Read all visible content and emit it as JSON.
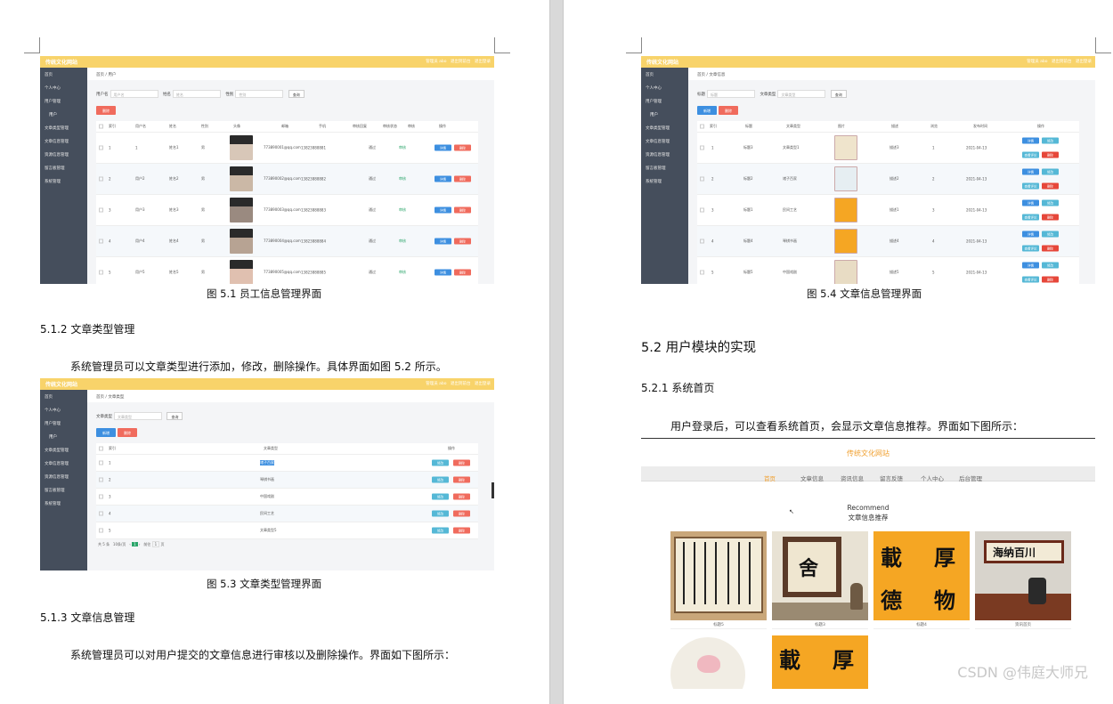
{
  "left_page": {
    "fig1_caption": "图 5.1 员工信息管理界面",
    "sec_513_heading": "5.1.2 文章类型管理",
    "sec_513_para": "系统管理员可以文章类型进行添加，修改，删除操作。具体界面如图 5.2 所示。",
    "fig3_caption": "图 5.3 文章类型管理界面",
    "sec_info_heading": "5.1.3 文章信息管理",
    "sec_info_para": "系统管理员可以对用户提交的文章信息进行审核以及删除操作。界面如下图所示："
  },
  "right_page": {
    "fig4_caption": "图 5.4 文章信息管理界面",
    "h2": "5.2 用户模块的实现",
    "sec_521_heading": "5.2.1 系统首页",
    "sec_521_para": "用户登录后，可以查看系统首页，会显示文章信息推荐。界面如下图所示："
  },
  "admin": {
    "brand": "传统文化网站",
    "top_right": "管理员 abo　退出到前台　退出登录",
    "sidebar": [
      "首页",
      "个人中心",
      "用户管理",
      "用户",
      "文章类型管理",
      "文章信息管理",
      "资源信息管理",
      "留言板管理",
      "系统管理"
    ],
    "search_btn": "查询",
    "add_btn": "新增",
    "del_btn": "删除",
    "detail_btn": "详情",
    "edit_btn": "修改",
    "review_btn": "查看评论"
  },
  "fig1": {
    "crumb": "首页 / 用户",
    "search": {
      "l1": "用户名",
      "p1": "用户名",
      "l2": "姓名",
      "p2": "姓名",
      "l3": "性别",
      "p3": "性别"
    },
    "headers": [
      "索引",
      "用户名",
      "姓名",
      "性别",
      "头像",
      "邮箱",
      "手机",
      "审核回复",
      "审核状态",
      "审核",
      "操作"
    ],
    "rows": [
      {
        "i": "1",
        "u": "1",
        "n": "姓名1",
        "g": "男",
        "e": "773890001@qq.com",
        "p": "13823888881",
        "s": "通过",
        "a": "审核"
      },
      {
        "i": "2",
        "u": "用户2",
        "n": "姓名2",
        "g": "男",
        "e": "773890002@qq.com",
        "p": "13823888882",
        "s": "通过",
        "a": "审核"
      },
      {
        "i": "3",
        "u": "用户3",
        "n": "姓名3",
        "g": "男",
        "e": "773890003@qq.com",
        "p": "13823888883",
        "s": "通过",
        "a": "审核"
      },
      {
        "i": "4",
        "u": "用户4",
        "n": "姓名4",
        "g": "男",
        "e": "773890004@qq.com",
        "p": "13823888884",
        "s": "通过",
        "a": "审核"
      },
      {
        "i": "5",
        "u": "用户5",
        "n": "姓名5",
        "g": "男",
        "e": "773890005@qq.com",
        "p": "13823888885",
        "s": "通过",
        "a": "审核"
      }
    ]
  },
  "fig3": {
    "crumb": "首页 / 文章类型",
    "search": {
      "l1": "文章类型",
      "p1": "文章类型"
    },
    "headers": [
      "索引",
      "文章类型",
      "操作"
    ],
    "rows": [
      {
        "i": "1",
        "t": "诸子百家"
      },
      {
        "i": "2",
        "t": "琴棋书画"
      },
      {
        "i": "3",
        "t": "中国戏剧"
      },
      {
        "i": "4",
        "t": "民间工艺"
      },
      {
        "i": "5",
        "t": "文章类型5"
      }
    ],
    "pager": {
      "total": "共 5 条",
      "size": "10条/页",
      "page": "1",
      "goto": "前往",
      "unit": "页"
    }
  },
  "fig4": {
    "crumb": "首页 / 文章信息",
    "search": {
      "l1": "标题",
      "p1": "标题",
      "l2": "文章类型",
      "p2": "文章类型"
    },
    "headers": [
      "索引",
      "标题",
      "文章类型",
      "图片",
      "描述",
      "浏览",
      "发布时间",
      "操作"
    ],
    "rows": [
      {
        "i": "1",
        "t": "标题3",
        "k": "文章类型1",
        "d": "描述3",
        "v": "1",
        "time": "2021-04-13"
      },
      {
        "i": "2",
        "t": "标题2",
        "k": "诸子百家",
        "d": "描述2",
        "v": "2",
        "time": "2021-04-13"
      },
      {
        "i": "3",
        "t": "标题1",
        "k": "民间工艺",
        "d": "描述1",
        "v": "3",
        "time": "2021-04-13"
      },
      {
        "i": "4",
        "t": "标题4",
        "k": "琴棋书画",
        "d": "描述4",
        "v": "4",
        "time": "2021-04-13"
      },
      {
        "i": "5",
        "t": "标题5",
        "k": "中国戏剧",
        "d": "描述5",
        "v": "5",
        "time": "2021-04-13"
      }
    ]
  },
  "site": {
    "title": "传统文化网站",
    "nav": [
      "首页",
      "文章信息",
      "资讯信息",
      "留言反馈",
      "个人中心",
      "后台管理"
    ],
    "rec_en": "Recommend",
    "rec_cn": "文章信息推荐",
    "cards": [
      "标题5",
      "标题3",
      "标题4",
      "资讯首页"
    ]
  },
  "watermark": "CSDN @伟庭大师兄",
  "colors": {
    "topbar": "#f8d36a",
    "sidebar": "#454e5c",
    "primary": "#3d8fe0",
    "danger": "#f06b5d",
    "site_accent": "#f0a030"
  }
}
